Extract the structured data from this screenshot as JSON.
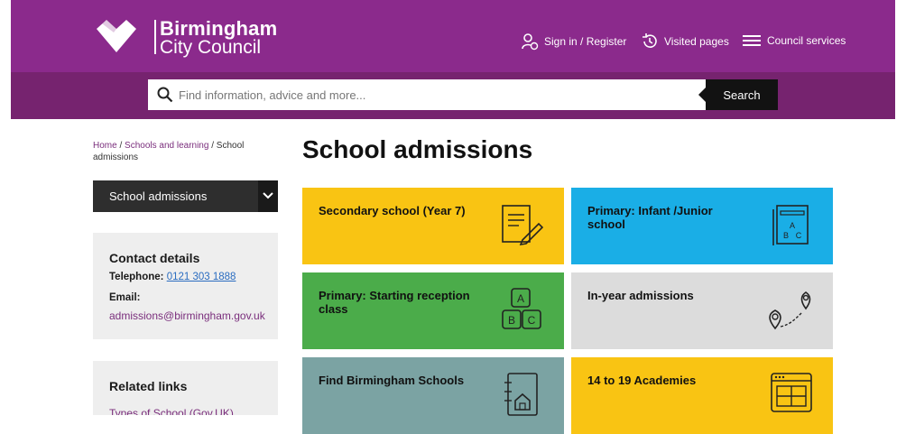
{
  "header": {
    "logo": {
      "line1": "Birmingham",
      "line2": "City Council",
      "mark_icon": "heart-logo"
    },
    "links": [
      {
        "label": "Sign in / Register",
        "icon": "user-icon"
      },
      {
        "label": "Visited pages",
        "icon": "history-icon"
      },
      {
        "label": "Council services",
        "icon": "menu-icon"
      }
    ],
    "search": {
      "placeholder": "Find information, advice and more...",
      "value": "",
      "button_label": "Search"
    }
  },
  "breadcrumb": [
    {
      "label": "Home"
    },
    {
      "label": "Schools and learning"
    },
    {
      "label": "School admissions"
    }
  ],
  "breadcrumb_separator": "/",
  "page_title": "School admissions",
  "sidebar": {
    "select_label": "School admissions",
    "contact": {
      "title": "Contact details",
      "telephone_label": "Telephone:",
      "telephone": "0121 303 1888",
      "email_label": "Email:",
      "email": "admissions@birmingham.gov.uk"
    },
    "related": {
      "title": "Related links",
      "first_link": "Types of School (Gov.UK)"
    }
  },
  "cards": [
    {
      "title": "Secondary school (Year 7)",
      "icon": "notepad-pencil-icon",
      "color": "#f9c413"
    },
    {
      "title": "Primary: Infant /Junior school",
      "icon": "abc-book-icon",
      "color": "#1aaee6"
    },
    {
      "title": "Primary: Starting reception class",
      "icon": "abc-blocks-icon",
      "color": "#4bac4a"
    },
    {
      "title": "In-year admissions",
      "icon": "map-route-icon",
      "color": "#dcdcdc"
    },
    {
      "title": "Find Birmingham Schools",
      "icon": "school-directory-icon",
      "color": "#7ba3a3"
    },
    {
      "title": "14 to 19 Academies",
      "icon": "website-layout-icon",
      "color": "#f9c413"
    }
  ],
  "colors": {
    "brand": "#8b2a8c",
    "brand_dark": "#76236f",
    "link": "#7a2e7c"
  }
}
